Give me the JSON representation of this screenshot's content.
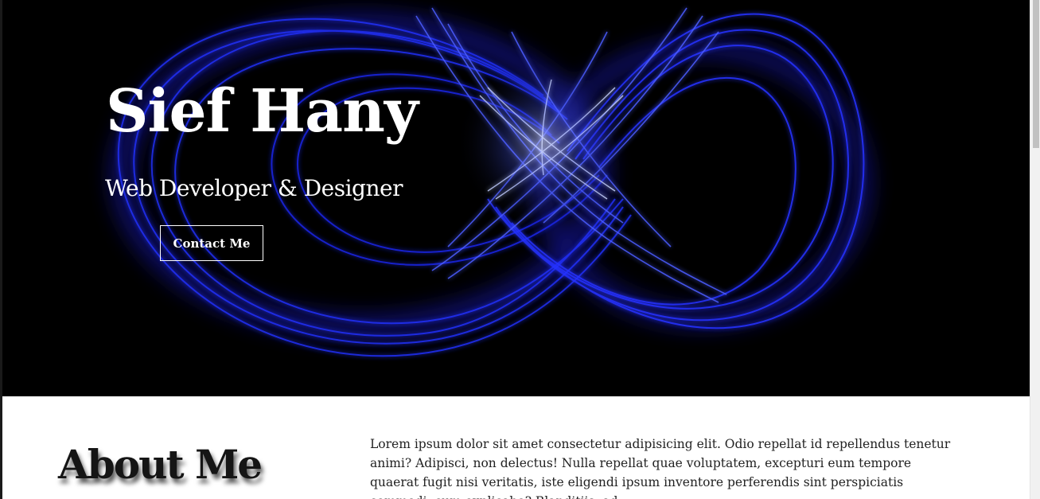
{
  "hero": {
    "title": "Sief Hany",
    "subtitle": "Web Developer & Designer",
    "contact_button": "Contact Me"
  },
  "about": {
    "heading": "About Me",
    "paragraph": "Lorem ipsum dolor sit amet consectetur adipisicing elit. Odio repellat id repellendus tenetur animi? Adipisci, non delectus! Nulla repellat quae voluptatem, excepturi eum tempore quaerat fugit nisi veritatis, iste eligendi ipsum inventore perferendis sint perspiciatis commodi, cum explicabo? Blanditiis, ad"
  },
  "colors": {
    "hero_background": "#000000",
    "light_trail": "#1f2cff",
    "light_trail_glow": "#b9c8ff",
    "text_light": "#ffffff",
    "text_dark": "#151515"
  },
  "icons": {
    "hero_art": "blue-light-infinity-image"
  }
}
